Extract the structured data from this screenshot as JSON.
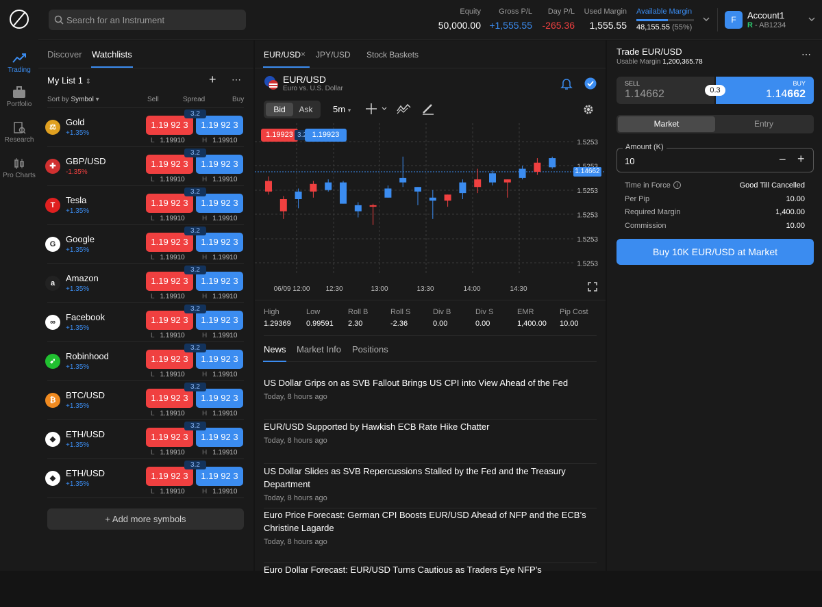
{
  "nav": [
    {
      "label": "Trading",
      "icon": "trading-chart-icon",
      "active": true
    },
    {
      "label": "Portfolio",
      "icon": "briefcase-icon",
      "active": false
    },
    {
      "label": "Research",
      "icon": "research-icon",
      "active": false
    },
    {
      "label": "Pro Charts",
      "icon": "candles-icon",
      "active": false
    }
  ],
  "search": {
    "placeholder": "Search for an Instrument"
  },
  "stats": {
    "equity": {
      "label": "Equity",
      "value": "50,000.00"
    },
    "gross": {
      "label": "Gross P/L",
      "value": "+1,555.55"
    },
    "day": {
      "label": "Day P/L",
      "value": "-265.36"
    },
    "used": {
      "label": "Used Margin",
      "value": "1,555.55"
    },
    "avail": {
      "label": "Available Margin",
      "value": "48,155.55",
      "pct": "(55%)",
      "fill": 0.55
    }
  },
  "account": {
    "initial": "F",
    "name": "Account1",
    "type": "R",
    "id": "- AB1234"
  },
  "watchlist": {
    "tabs": [
      "Discover",
      "Watchlists"
    ],
    "list_name": "My List 1",
    "sort_label": "Sort by",
    "sort_value": "Symbol",
    "col_sell": "Sell",
    "col_spread": "Spread",
    "col_buy": "Buy",
    "add_label": "+ Add more symbols",
    "rows": [
      {
        "name": "Gold",
        "change": "+1.35%",
        "neg": false,
        "icon": "gold-icon",
        "glyph": "⚖",
        "bg": "#e0a020"
      },
      {
        "name": "GBP/USD",
        "change": "-1.35%",
        "neg": true,
        "icon": "uk-us-flag-icon",
        "glyph": "✚",
        "bg": "#d03030"
      },
      {
        "name": "Tesla",
        "change": "+1.35%",
        "neg": false,
        "icon": "tesla-icon",
        "glyph": "T",
        "bg": "#e02020"
      },
      {
        "name": "Google",
        "change": "+1.35%",
        "neg": false,
        "icon": "google-icon",
        "glyph": "G",
        "bg": "#ffffff"
      },
      {
        "name": "Amazon",
        "change": "+1.35%",
        "neg": false,
        "icon": "amazon-icon",
        "glyph": "a",
        "bg": "#222222"
      },
      {
        "name": "Facebook",
        "change": "+1.35%",
        "neg": false,
        "icon": "meta-icon",
        "glyph": "∞",
        "bg": "#ffffff"
      },
      {
        "name": "Robinhood",
        "change": "+1.35%",
        "neg": false,
        "icon": "robinhood-icon",
        "glyph": "➶",
        "bg": "#20c030"
      },
      {
        "name": "BTC/USD",
        "change": "+1.35%",
        "neg": false,
        "icon": "bitcoin-icon",
        "glyph": "₿",
        "bg": "#f08a20"
      },
      {
        "name": "ETH/USD",
        "change": "+1.35%",
        "neg": false,
        "icon": "ethereum-icon",
        "glyph": "◆",
        "bg": "#ffffff"
      },
      {
        "name": "ETH/USD",
        "change": "+1.35%",
        "neg": false,
        "icon": "ethereum-icon",
        "glyph": "◆",
        "bg": "#ffffff"
      }
    ],
    "price_pre": "1.19 92 ",
    "price_pip": "3",
    "spread": "3.2",
    "low_label": "L",
    "low": "1.19910",
    "high_label": "H",
    "high": "1.19910"
  },
  "center": {
    "tabs": [
      "EUR/USD",
      "JPY/USD",
      "Stock Baskets"
    ],
    "symbol": "EUR/USD",
    "desc": "Euro vs. U.S. Dollar",
    "bid": "Bid",
    "ask": "Ask",
    "timeframe": "5m",
    "bid_price": "1.19923",
    "spread": "3.2",
    "ask_price": "1.19923",
    "current_price": "1.14662",
    "y_labels": [
      "1.5253",
      "1.5253",
      "1.5253",
      "1.5253",
      "1.5253",
      "1.5253"
    ],
    "x_labels": [
      "06/09 12:00",
      "12:30",
      "13:00",
      "13:30",
      "14:00",
      "14:30"
    ],
    "info": [
      {
        "label": "High",
        "value": "1.29369"
      },
      {
        "label": "Low",
        "value": "0.99591"
      },
      {
        "label": "Roll B",
        "value": "2.30"
      },
      {
        "label": "Roll S",
        "value": "-2.36"
      },
      {
        "label": "Div B",
        "value": "0.00"
      },
      {
        "label": "Div S",
        "value": "0.00"
      },
      {
        "label": "EMR",
        "value": "1,400.00"
      },
      {
        "label": "Pip Cost",
        "value": "10.00"
      }
    ],
    "news_tabs": [
      "News",
      "Market Info",
      "Positions"
    ],
    "news": [
      {
        "title": "US Dollar Grips on as SVB Fallout Brings US CPI into View Ahead of the Fed",
        "date": "Today, 8 hours ago"
      },
      {
        "title": "EUR/USD Supported by Hawkish ECB Rate Hike Chatter",
        "date": "Today, 8 hours ago"
      },
      {
        "title": "US Dollar Slides as SVB Repercussions Stalled by the Fed and the Treasury Department",
        "date": "Today, 8 hours ago"
      },
      {
        "title": "Euro Price Forecast: German CPI Boosts EUR/USD Ahead of NFP and the ECB’s Christine Lagarde",
        "date": "Today, 8 hours ago"
      },
      {
        "title": "Euro Dollar Forecast: EUR/USD Turns Cautious as Traders Eye NFP’s",
        "date": ""
      }
    ]
  },
  "chart_data": {
    "type": "candlestick",
    "x": [
      "06/09 12:00",
      "12:30",
      "13:00",
      "13:30",
      "14:00",
      "14:30"
    ],
    "candles": [
      {
        "o": 0.62,
        "c": 0.55,
        "h": 0.65,
        "l": 0.53,
        "up": false
      },
      {
        "o": 0.5,
        "c": 0.42,
        "h": 0.52,
        "l": 0.37,
        "up": false
      },
      {
        "o": 0.5,
        "c": 0.55,
        "h": 0.57,
        "l": 0.44,
        "up": true
      },
      {
        "o": 0.6,
        "c": 0.55,
        "h": 0.62,
        "l": 0.51,
        "up": false
      },
      {
        "o": 0.56,
        "c": 0.61,
        "h": 0.63,
        "l": 0.55,
        "up": true
      },
      {
        "o": 0.47,
        "c": 0.61,
        "h": 0.62,
        "l": 0.47,
        "up": true
      },
      {
        "o": 0.42,
        "c": 0.46,
        "h": 0.48,
        "l": 0.38,
        "up": true
      },
      {
        "o": 0.46,
        "c": 0.45,
        "h": 0.47,
        "l": 0.33,
        "up": false
      },
      {
        "o": 0.51,
        "c": 0.57,
        "h": 0.59,
        "l": 0.51,
        "up": true
      },
      {
        "o": 0.61,
        "c": 0.64,
        "h": 0.78,
        "l": 0.58,
        "up": true
      },
      {
        "o": 0.55,
        "c": 0.58,
        "h": 0.58,
        "l": 0.46,
        "up": true
      },
      {
        "o": 0.49,
        "c": 0.51,
        "h": 0.56,
        "l": 0.37,
        "up": true
      },
      {
        "o": 0.53,
        "c": 0.49,
        "h": 0.53,
        "l": 0.45,
        "up": false
      },
      {
        "o": 0.54,
        "c": 0.61,
        "h": 0.63,
        "l": 0.5,
        "up": true
      },
      {
        "o": 0.63,
        "c": 0.58,
        "h": 0.7,
        "l": 0.54,
        "up": false
      },
      {
        "o": 0.61,
        "c": 0.67,
        "h": 0.69,
        "l": 0.59,
        "up": true
      },
      {
        "o": 0.63,
        "c": 0.61,
        "h": 0.63,
        "l": 0.51,
        "up": false
      },
      {
        "o": 0.64,
        "c": 0.7,
        "h": 0.72,
        "l": 0.63,
        "up": true
      },
      {
        "o": 0.74,
        "c": 0.68,
        "h": 0.77,
        "l": 0.66,
        "up": false
      },
      {
        "o": 0.71,
        "c": 0.77,
        "h": 0.78,
        "l": 0.7,
        "up": true
      }
    ]
  },
  "trade": {
    "title": "Trade EUR/USD",
    "margin_label": "Usable Margin",
    "margin": "1,200,365.78",
    "sell_label": "SELL",
    "sell_pre": "1.14",
    "sell_big": "662",
    "buy_label": "BUY",
    "buy_pre": "1.14",
    "buy_big": "662",
    "spread": "0.3",
    "types": [
      "Market",
      "Entry"
    ],
    "amount_label": "Amount (K)",
    "amount": "10",
    "rows": [
      {
        "label": "Time in Force",
        "value": "Good Till Cancelled"
      },
      {
        "label": "Per Pip",
        "value": "10.00"
      },
      {
        "label": "Required Margin",
        "value": "1,400.00"
      },
      {
        "label": "Commission",
        "value": "10.00"
      }
    ],
    "cta": "Buy 10K EUR/USD at Market"
  },
  "colors": {
    "accent": "#3b8cf0",
    "sell": "#f04040"
  }
}
